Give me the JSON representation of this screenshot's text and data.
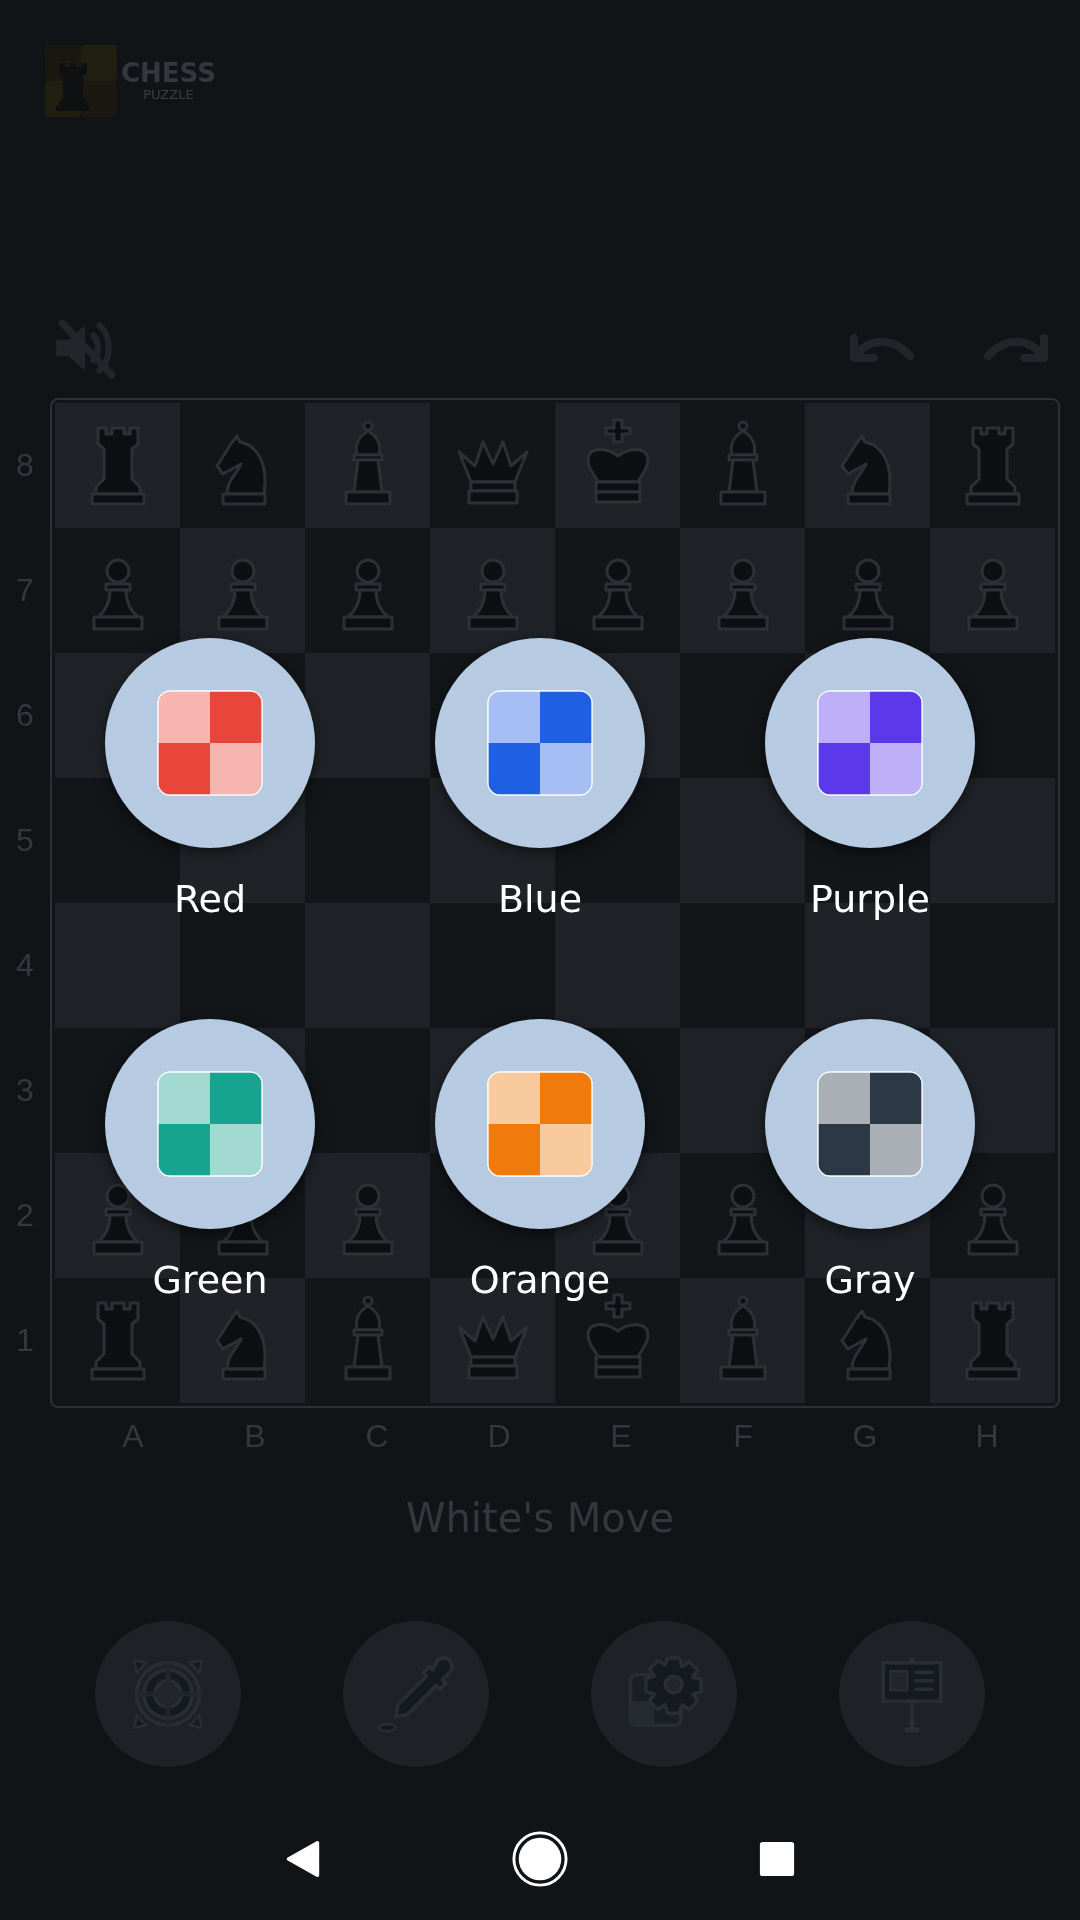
{
  "app": {
    "title": "CHESS",
    "subtitle": "PUZZLE"
  },
  "sound": {
    "muted": true
  },
  "board": {
    "ranks": [
      {
        "label": "8",
        "squares": [
          {
            "kind": "rook"
          },
          {
            "kind": "knight"
          },
          {
            "kind": "bishop"
          },
          {
            "kind": "queen"
          },
          {
            "kind": "king"
          },
          {
            "kind": "bishop"
          },
          {
            "kind": "knight"
          },
          {
            "kind": "rook"
          }
        ]
      },
      {
        "label": "7",
        "squares": [
          {
            "kind": "pawn"
          },
          {
            "kind": "pawn"
          },
          {
            "kind": "pawn"
          },
          {
            "kind": "pawn"
          },
          {
            "kind": "pawn"
          },
          {
            "kind": "pawn"
          },
          {
            "kind": "pawn"
          },
          {
            "kind": "pawn"
          }
        ]
      },
      {
        "label": "6",
        "squares": [
          {
            "kind": "empty"
          },
          {
            "kind": "empty"
          },
          {
            "kind": "empty"
          },
          {
            "kind": "empty"
          },
          {
            "kind": "empty"
          },
          {
            "kind": "empty"
          },
          {
            "kind": "empty"
          },
          {
            "kind": "empty"
          }
        ]
      },
      {
        "label": "5",
        "squares": [
          {
            "kind": "empty"
          },
          {
            "kind": "empty"
          },
          {
            "kind": "empty"
          },
          {
            "kind": "empty"
          },
          {
            "kind": "empty"
          },
          {
            "kind": "empty"
          },
          {
            "kind": "empty"
          },
          {
            "kind": "empty"
          }
        ]
      },
      {
        "label": "4",
        "squares": [
          {
            "kind": "empty"
          },
          {
            "kind": "empty"
          },
          {
            "kind": "empty"
          },
          {
            "kind": "empty"
          },
          {
            "kind": "empty"
          },
          {
            "kind": "empty"
          },
          {
            "kind": "empty"
          },
          {
            "kind": "empty"
          }
        ]
      },
      {
        "label": "3",
        "squares": [
          {
            "kind": "empty"
          },
          {
            "kind": "empty"
          },
          {
            "kind": "empty"
          },
          {
            "kind": "empty"
          },
          {
            "kind": "empty"
          },
          {
            "kind": "empty"
          },
          {
            "kind": "empty"
          },
          {
            "kind": "empty"
          }
        ]
      },
      {
        "label": "2",
        "squares": [
          {
            "kind": "pawn"
          },
          {
            "kind": "pawn"
          },
          {
            "kind": "pawn"
          },
          {
            "kind": "empty"
          },
          {
            "kind": "pawn"
          },
          {
            "kind": "pawn"
          },
          {
            "kind": "empty"
          },
          {
            "kind": "pawn"
          }
        ]
      },
      {
        "label": "1",
        "squares": [
          {
            "kind": "rook"
          },
          {
            "kind": "knight"
          },
          {
            "kind": "bishop"
          },
          {
            "kind": "queen"
          },
          {
            "kind": "king"
          },
          {
            "kind": "bishop"
          },
          {
            "kind": "knight"
          },
          {
            "kind": "rook"
          }
        ]
      }
    ],
    "files": [
      "A",
      "B",
      "C",
      "D",
      "E",
      "F",
      "G",
      "H"
    ]
  },
  "status": "White's Move",
  "theme_options": [
    {
      "label": "Red",
      "color": "#e8463a"
    },
    {
      "label": "Blue",
      "color": "#1e5fe3"
    },
    {
      "label": "Purple",
      "color": "#5b38ea"
    },
    {
      "label": "Green",
      "color": "#16a38f"
    },
    {
      "label": "Orange",
      "color": "#f07a0c"
    },
    {
      "label": "Gray",
      "color": "#2b3846"
    }
  ],
  "toolbar": [
    {
      "kind": "target"
    },
    {
      "kind": "eyedropper"
    },
    {
      "kind": "settings"
    },
    {
      "kind": "sign"
    }
  ]
}
